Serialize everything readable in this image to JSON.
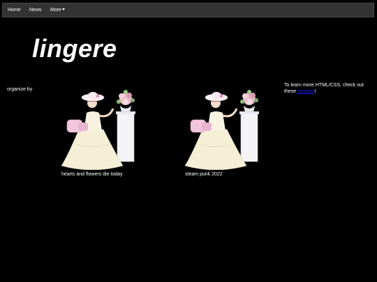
{
  "nav": {
    "home": "Home",
    "news": "News",
    "more": "More"
  },
  "title": "lingere",
  "organize_label": "organize by",
  "sidebar": {
    "text_before": "To learn more HTML/CSS, check out these ",
    "link_text": "tutorials",
    "text_after": "!"
  },
  "gallery": [
    {
      "caption": "hearts and flowers die today",
      "icon": "victorian-lady-image"
    },
    {
      "caption": "steam punk 2022",
      "icon": "victorian-lady-image"
    }
  ],
  "colors": {
    "background": "#000000",
    "navbar": "#333333",
    "link": "#1a1aff"
  }
}
